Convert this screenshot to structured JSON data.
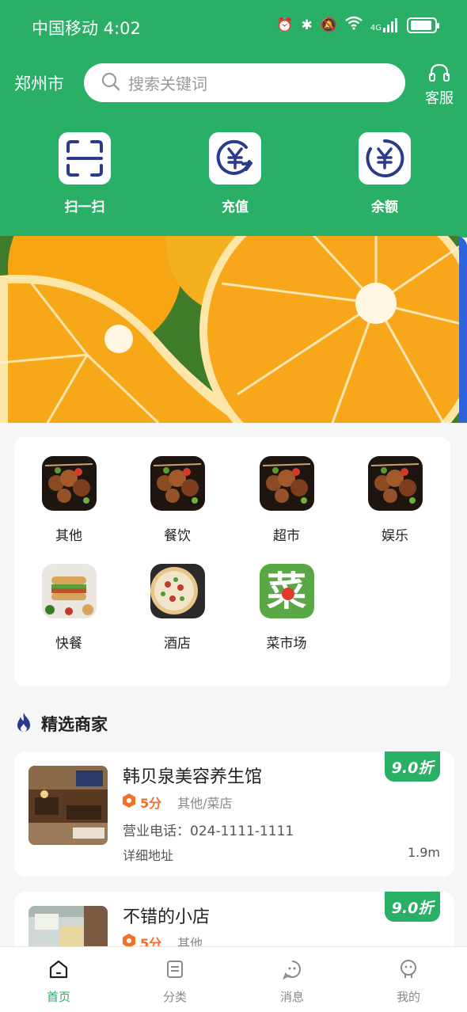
{
  "status_bar": {
    "carrier_time": "中国移动 4:02",
    "network": "4G"
  },
  "header": {
    "city": "郑州市",
    "search_placeholder": "搜索关键词",
    "service_label": "客服",
    "quick_actions": [
      {
        "label": "扫一扫",
        "icon": "scan-icon"
      },
      {
        "label": "充值",
        "icon": "recharge-yuan-icon"
      },
      {
        "label": "余额",
        "icon": "balance-yuan-icon"
      }
    ]
  },
  "banner": {
    "image": "orange-slices-photo"
  },
  "categories": [
    {
      "label": "其他",
      "image": "bbq-skewers-photo"
    },
    {
      "label": "餐饮",
      "image": "bbq-skewers-photo"
    },
    {
      "label": "超市",
      "image": "bbq-skewers-photo"
    },
    {
      "label": "娱乐",
      "image": "bbq-skewers-photo"
    },
    {
      "label": "快餐",
      "image": "sandwich-fastfood-photo"
    },
    {
      "label": "酒店",
      "image": "pizza-photo"
    },
    {
      "label": "菜市场",
      "image": "vegetable-market-logo",
      "logo_text": "菜"
    }
  ],
  "section": {
    "title": "精选商家"
  },
  "stores": [
    {
      "name": "韩贝泉美容养生馆",
      "score": "5分",
      "category": "其他/菜店",
      "phone": "营业电话：024-1111-1111",
      "address": "详细地址",
      "distance": "1.9m",
      "discount": "9.0折"
    },
    {
      "name": "不错的小店",
      "score": "5分",
      "category": "其他",
      "discount": "9.0折"
    }
  ],
  "tabbar": [
    {
      "label": "首页",
      "icon": "home-icon",
      "active": true
    },
    {
      "label": "分类",
      "icon": "category-icon",
      "active": false
    },
    {
      "label": "消息",
      "icon": "message-icon",
      "active": false
    },
    {
      "label": "我的",
      "icon": "profile-icon",
      "active": false
    }
  ],
  "colors": {
    "primary": "#2aaf66",
    "score": "#f2702a",
    "icon_blue": "#2c3a8c"
  }
}
